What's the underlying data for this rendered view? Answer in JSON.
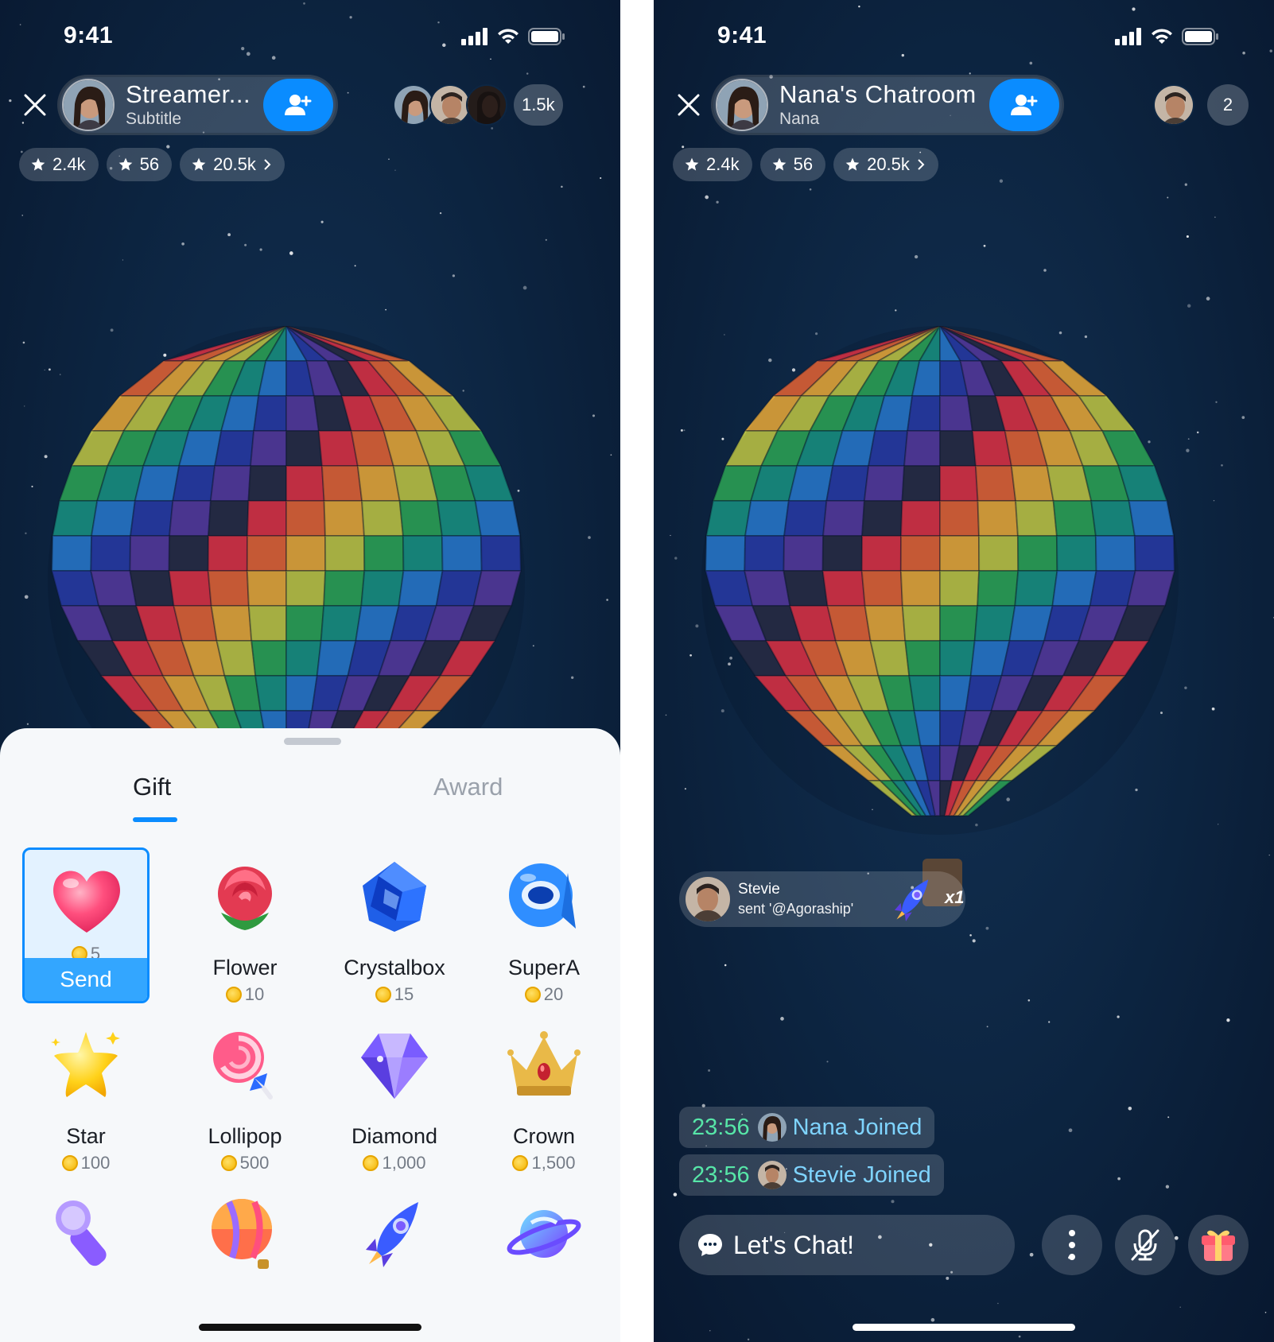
{
  "status": {
    "time": "9:41"
  },
  "left": {
    "host": {
      "name": "Streamer...",
      "subtitle": "Subtitle"
    },
    "audience_count": "1.5k",
    "stats": [
      "2.4k",
      "56",
      "20.5k"
    ],
    "tabs": {
      "gift": "Gift",
      "award": "Award"
    },
    "send_label": "Send",
    "gifts": [
      {
        "name": "",
        "price": "5",
        "icon": "heart-icon"
      },
      {
        "name": "Flower",
        "price": "10",
        "icon": "rose-icon"
      },
      {
        "name": "Crystalbox",
        "price": "15",
        "icon": "crystalbox-icon"
      },
      {
        "name": "SuperA",
        "price": "20",
        "icon": "supera-icon"
      },
      {
        "name": "Star",
        "price": "100",
        "icon": "star-icon"
      },
      {
        "name": "Lollipop",
        "price": "500",
        "icon": "lollipop-icon"
      },
      {
        "name": "Diamond",
        "price": "1,000",
        "icon": "diamond-icon"
      },
      {
        "name": "Crown",
        "price": "1,500",
        "icon": "crown-icon"
      },
      {
        "name": "",
        "price": "",
        "icon": "microphone-icon"
      },
      {
        "name": "",
        "price": "",
        "icon": "hot-air-balloon-icon"
      },
      {
        "name": "",
        "price": "",
        "icon": "rocket-icon"
      },
      {
        "name": "",
        "price": "",
        "icon": "planet-icon"
      }
    ]
  },
  "right": {
    "host": {
      "name": "Nana's Chatroom",
      "subtitle": "Nana"
    },
    "audience_count": "2",
    "stats": [
      "2.4k",
      "56",
      "20.5k"
    ],
    "gift_toast": {
      "sender": "Stevie",
      "message": "sent '@Agoraship'",
      "count": "x1"
    },
    "chat": [
      {
        "time": "23:56",
        "text": "Nana Joined"
      },
      {
        "time": "23:56",
        "text": "Stevie Joined"
      }
    ],
    "input_placeholder": "Let's Chat!"
  },
  "colors": {
    "accent": "#0a8cff",
    "join_time": "#57e6a8",
    "join_text": "#7fd4ff",
    "bg": "#0d2643"
  }
}
